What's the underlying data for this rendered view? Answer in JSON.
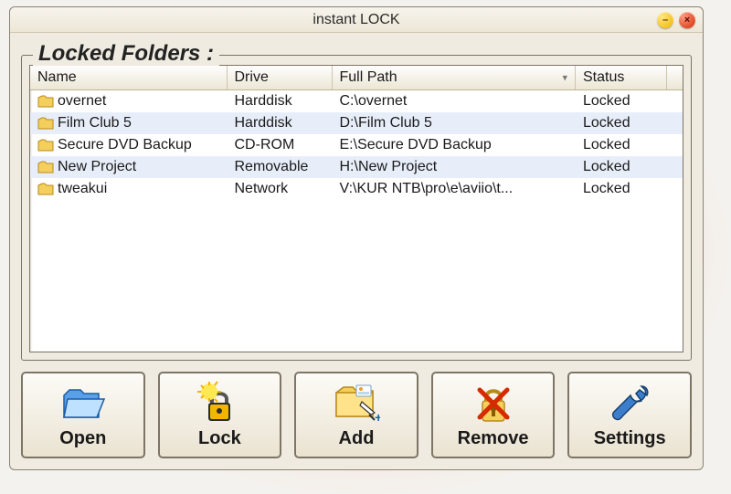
{
  "window": {
    "title": "instant LOCK"
  },
  "fieldset": {
    "legend": "Locked Folders :"
  },
  "table": {
    "headers": {
      "name": "Name",
      "drive": "Drive",
      "path": "Full Path",
      "status": "Status"
    },
    "rows": [
      {
        "name": "overnet",
        "drive": "Harddisk",
        "path": "C:\\overnet",
        "status": "Locked",
        "selected": false
      },
      {
        "name": "Film Club 5",
        "drive": "Harddisk",
        "path": "D:\\Film Club 5",
        "status": "Locked",
        "selected": true
      },
      {
        "name": "Secure DVD Backup",
        "drive": "CD-ROM",
        "path": "E:\\Secure DVD Backup",
        "status": "Locked",
        "selected": false
      },
      {
        "name": "New Project",
        "drive": "Removable",
        "path": "H:\\New Project",
        "status": "Locked",
        "selected": true
      },
      {
        "name": "tweakui",
        "drive": "Network",
        "path": "V:\\KUR NTB\\pro\\e\\aviio\\t...",
        "status": "Locked",
        "selected": false
      }
    ]
  },
  "buttons": {
    "open": "Open",
    "lock": "Lock",
    "add": "Add",
    "remove": "Remove",
    "settings": "Settings"
  },
  "sort_indicator": "▾"
}
